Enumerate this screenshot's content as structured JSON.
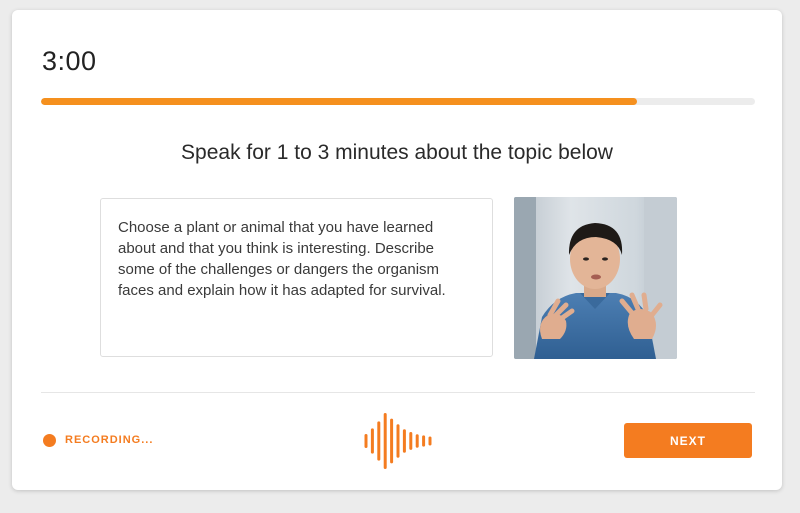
{
  "colors": {
    "accent": "#f47c20",
    "progress": "#f5901e",
    "track": "#ececec"
  },
  "timer": {
    "value": "3:00"
  },
  "progress": {
    "fraction": 0.835
  },
  "prompt": {
    "title": "Speak for 1 to 3 minutes about the topic below",
    "topic": "Choose a plant or animal that you have learned about and that you think is interesting. Describe some of the challenges or dangers the organism faces and explain how it has adapted for survival."
  },
  "video": {
    "icon": "speaker-video-thumbnail"
  },
  "recording": {
    "label": "RECORDING...",
    "icon": "record-dot-icon"
  },
  "waveform": {
    "icon": "audio-waveform-icon",
    "levels": [
      0.25,
      0.45,
      0.7,
      1.0,
      0.8,
      0.6,
      0.42,
      0.32,
      0.24,
      0.2,
      0.16
    ]
  },
  "actions": {
    "next_label": "NEXT"
  }
}
